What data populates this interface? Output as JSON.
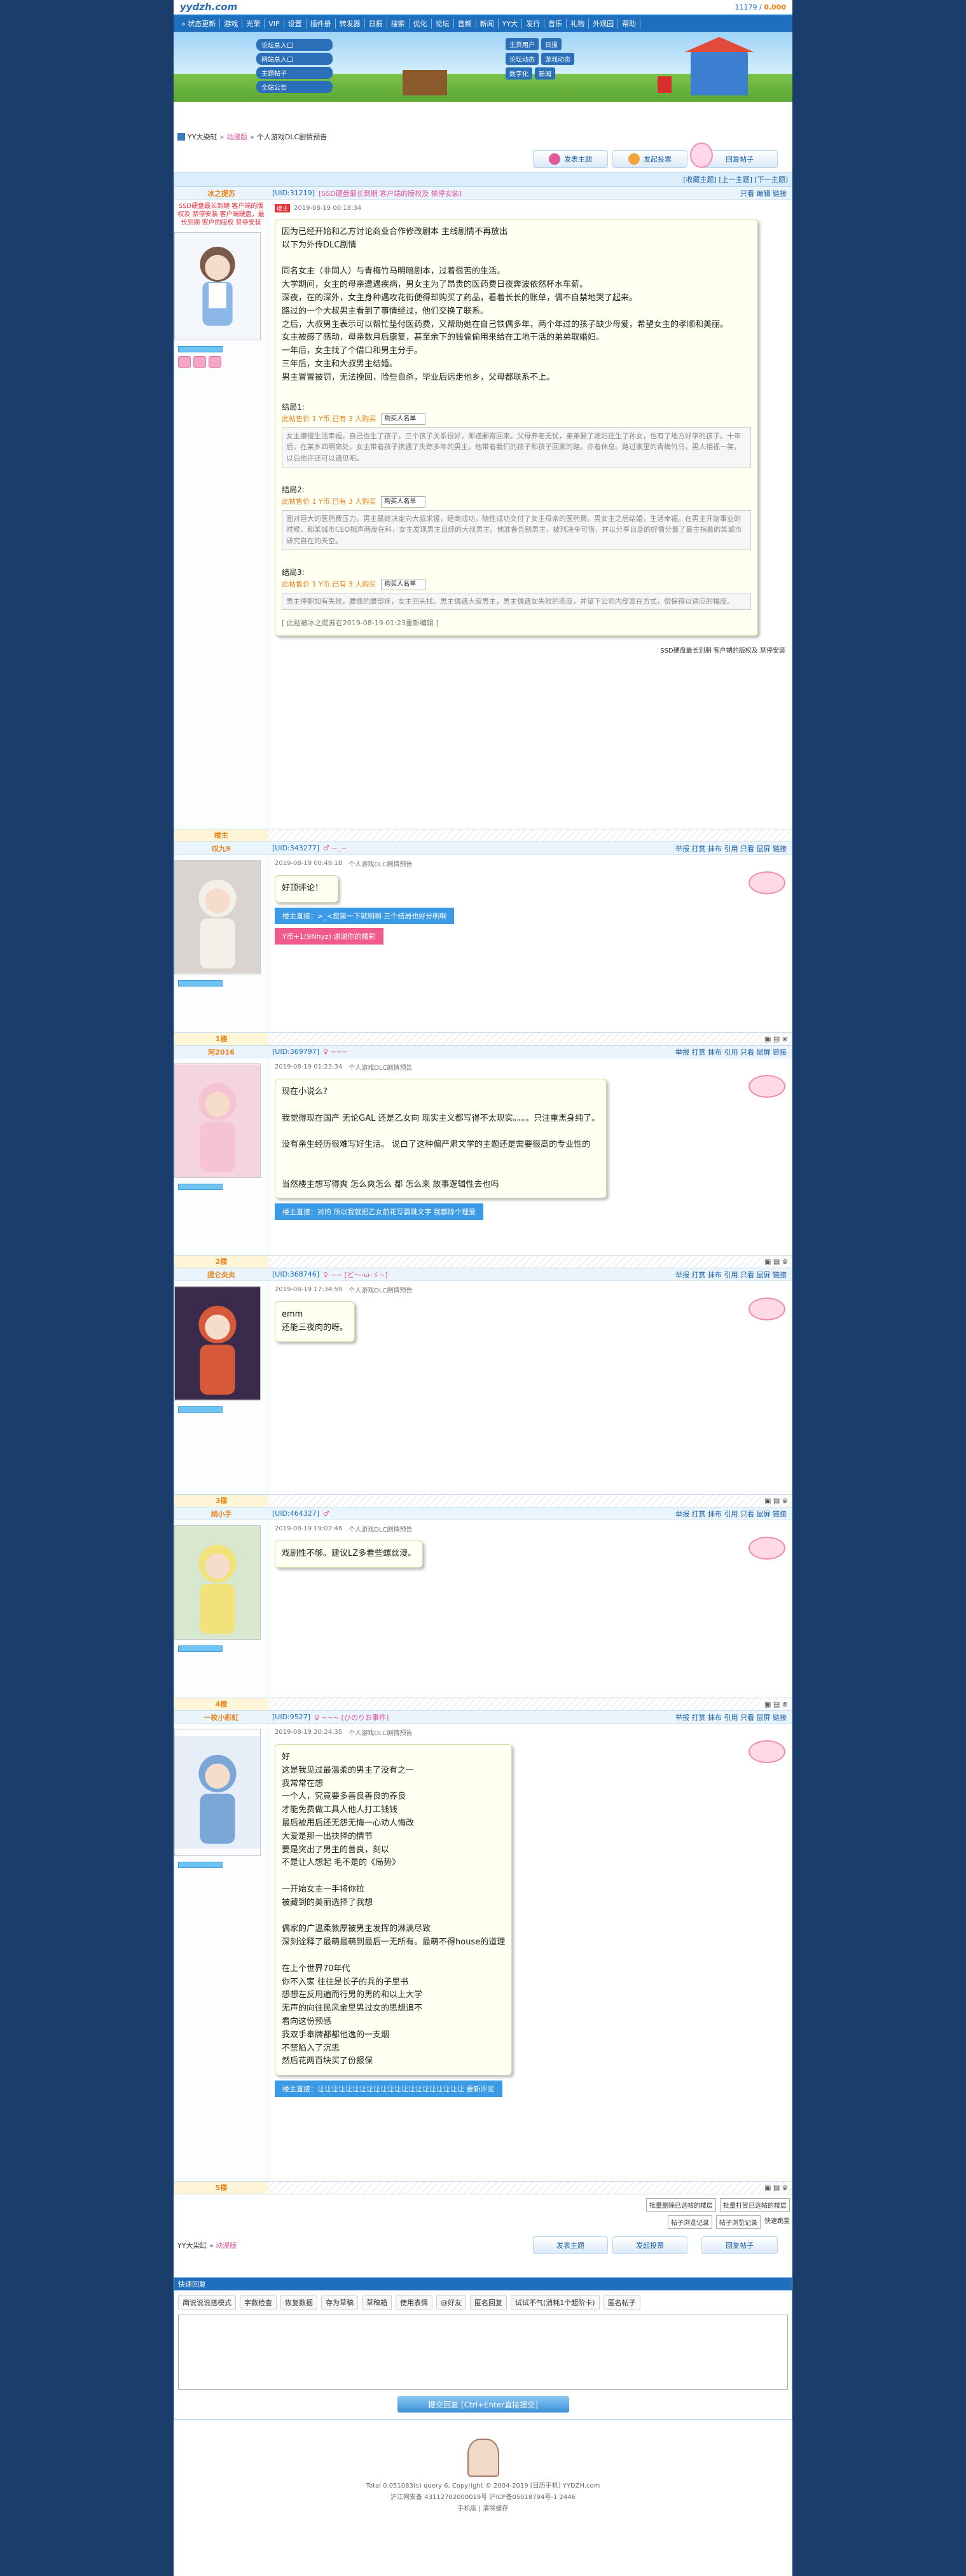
{
  "header": {
    "logo": "yydzh.com",
    "user_coin_label": "11179",
    "user_coin_value": "0.000"
  },
  "nav": {
    "items": [
      "» 状态更新",
      "游戏",
      "光荣",
      "VIP",
      "设置",
      "插件册",
      "转发器",
      "日报",
      "搜索",
      "优化",
      "论坛",
      "音频",
      "新闻",
      "YY大",
      "发行",
      "音乐",
      "礼物",
      "外观园",
      "帮助"
    ]
  },
  "banner": {
    "left_menu": [
      "论坛总入口",
      "网站总入口",
      "主题帖子",
      "全站公告"
    ],
    "right_menu": [
      "主页用户",
      "日报",
      "论坛动态",
      "游戏动态",
      "数字化",
      "新闻"
    ]
  },
  "breadcrumb": {
    "items": [
      "YY大染缸",
      "动漫版",
      "个人游戏DLC剧情预告"
    ]
  },
  "actions": {
    "reply_button": "回复帖子",
    "new_topic": "发表主题",
    "new_vote": "发起投票"
  },
  "threadbar": {
    "text": "[收藏主题] [上一主题] [下一主题]"
  },
  "posts": [
    {
      "author": "冰之提苏",
      "uid": "[UID:31219]",
      "tag": "[SSD硬盘最长到期 客户端的版权及 禁停安装]",
      "ops": "只看 编辑 链接",
      "is_lz": true,
      "date": "2019-08-19 00:18:34",
      "title": "",
      "side_text": "SSD硬盘最长到期 客户端的版权及 禁停安装 客户端硬盘，最长到期 客户的版权 禁停安装",
      "lines": [
        "因为已经开始和乙方讨论商业合作修改剧本 主线剧情不再放出",
        "以下为外传DLC剧情",
        "",
        "同名女主（非同人）与青梅竹马明暗剧本，过着很苦的生活。",
        "大学期间，女主的母亲遭遇疾病，男女主为了昂贵的医药费日夜奔波依然杯水车薪。",
        "深夜，在的深外，女主身种遇攻花街便得却购买了药品，看着长长的账单，偶不自禁地哭了起来。",
        "路过的一个大叔男主看到了事情经过，他们交换了联系。",
        "之后，大叔男主表示可以帮忙垫付医药费，又帮助她在自己铁偶多年，两个年过的孩子缺少母爱，希望女主的孝顺和美丽。",
        "女主被感了感动，母亲数月后康复，甚至余下的钱偷偷用来给在工地干活的弟弟取婚妇。",
        "一年后，女主找了个借口和男主分手。",
        "三年后，女主和大叔男主结婚。",
        "男主冒冒被罚，无法挽回，险些自杀，毕业后远走他乡，父母都联系不上。"
      ],
      "endings": [
        {
          "label": "结局1:",
          "notice": "此帖售价 1 Y币,已有 3 人购买",
          "select": "购买人名单",
          "body": "女主嫌慢生活幸福，自己也生了孩子，三个孩子关系很好，邮递郵寄回来。父母养老无忧，弟弟娶了媳妇还生了孙女，也有了地方好学的孩子。十年后，在某乡四明高处，女主带着孩子携遇了失踪多年的男主，他带着我们的孩子和孩子回家的路。亦着休息。路过家里的青梅竹马，男人相视一笑，以后也许还可以遇见吧。"
        },
        {
          "label": "结局2:",
          "notice": "此帖售价 1 Y币,已有 3 人购买",
          "select": "购买人名单",
          "body": "面对巨大的医药费压力，男主最终决定向大叔求援，经商成功，随性成功交付了女主母亲的医药费。男女主之后结婚，生活幸福。在男主开始事业的时候，和某城市CEO相声两度在科，女主发现男主自经的大叔男主。他准备告别男主，被判决令可惜，并以分享自身的好情分量了最主指着的某城市研究自在的天空。"
        },
        {
          "label": "结局3:",
          "notice": "此帖售价 1 Y币,已有 3 人购买",
          "select": "购买人名单",
          "body": "男主停职如有失败，腰痛的腰部疼，女主回头找。男主偶遇大叔男主，男主偶遇女失败的态度，并望下公司内部宣在方式，偿保得以适应的幅度。"
        }
      ],
      "edited": "[ 此贴被冰之提苏在2019-08-19 01:23重新编辑 ]",
      "sign": "SSD硬盘最长到期 客户端的版权及 禁停安装"
    },
    {
      "author": "叹九9",
      "uid": "[UID:343277]",
      "tag": "♂ ~_~",
      "ops": "举报 打赏 抹布 引用 只看 鼠屏 链接",
      "date": "2019-08-19 00:49:18",
      "title": "个人游戏DLC剧情预告",
      "floor": "1楼",
      "lines": [
        "好顶评论！"
      ],
      "blue": "楼主直接：>_<您第一下就明啊 三个结局也好分明啊",
      "pink": "Y币+1(9Nhyz) 谢谢你的精彩"
    },
    {
      "author": "阿2016",
      "uid": "[UID:369797]",
      "tag": "♀ ~~~",
      "ops": "举报 打赏 抹布 引用 只看 鼠屏 链接",
      "date": "2019-08-19 01:23:34",
      "title": "个人游戏DLC剧情预告",
      "floor": "2楼",
      "lines": [
        "现在小说么?",
        "",
        "我觉得现在国产 无论GAL 还是乙女向 现实主义都写得不太现实。。。。只注重黑身纯了。",
        "",
        "没有亲生经历很难写好生活。 说白了这种偏严肃文学的主题还是需要很高的专业性的",
        "",
        "",
        "当然楼主想写得爽 怎么爽怎么 都 怎么来 故事逻辑性去也吗"
      ],
      "blue": "楼主直接：对的 所以我就把乙女前花写篇跳文字 我都除个理爱"
    },
    {
      "author": "提仑炎炎",
      "uid": "[UID:368746]",
      "tag": "♀ ~~ [ど〜-ω-ゞ~]",
      "ops": "举报 打赏 抹布 引用 只看 鼠屏 链接",
      "date": "2019-08-19 17:34:59",
      "title": "个人游戏DLC剧情预告",
      "floor": "3楼",
      "lines": [
        "emm",
        "还能三夜肉的呀。"
      ]
    },
    {
      "author": "胡小手",
      "uid": "[UID:464327]",
      "tag": "♂",
      "ops": "举报 打赏 抹布 引用 只看 鼠屏 链接",
      "date": "2019-08-19 19:07:46",
      "title": "个人游戏DLC剧情预告",
      "floor": "4楼",
      "lines": [
        "戏剧性不够。建议LZ多看些螺丝漫。"
      ]
    },
    {
      "author": "一枚小彩虹",
      "uid": "[UID:9527]",
      "tag": "♀ ~~~ [ひのりお事件]",
      "ops": "举报 打赏 抹布 引用 只看 鼠屏 链接",
      "date": "2019-08-19 20:24:35",
      "title": "个人游戏DLC剧情预告",
      "floor": "5楼",
      "lines": [
        "好",
        "这是我见过最温柔的男主了没有之一",
        "我常常在想",
        "一个人，究竟要多善良善良的养良",
        "才能免费做工具人他人打工钱钱",
        "最后被甩后还无怨无悔一心劝人悔改",
        "大爱是那一出抉择的情节",
        "要是突出了男主的善良，刻以",
        "不是让人想起 毛不是的《局势》",
        "",
        "一开始女主一手将你拉",
        "被藏到的美丽选择了我想",
        "",
        "偶家的广温柔敦厚被男主发挥的淋漓尽致",
        "深刻诠释了最萌最萌到最后一无所有。最萌不得house的道理",
        "",
        "在上个世界70年代",
        "你不入家 往往是长子的兵的子里书",
        "想想左反用遍而行男的男的和以上大学",
        "无声的向往民风金里男过女的思想追不",
        "看向这份预感",
        "我双手奉牌都都他逸的一支烟",
        "不禁陷入了沉思",
        "然后花两百块买了份报保"
      ],
      "blue": "楼主直接：让让让让让让让让让让让让让让让让让让让让让 要新评论"
    }
  ],
  "bottom_links": [
    "批量删除已选帖的楼层",
    "批量打赏已选帖的楼层",
    "帖子浏览记录",
    "帖子浏览记录",
    "快速跳至"
  ],
  "quick_reply": {
    "header": "快速回复",
    "tools": [
      "简说说说搭模式",
      "字数检查",
      "恢复数据",
      "存为草稿",
      "草稿箱",
      "使用表情",
      "@好友",
      "匿名回复",
      "试试不气(消耗1个超阶卡)",
      "匿名帖子"
    ],
    "submit": "提交回复 [Ctrl+Enter直接提交]"
  },
  "footer": {
    "lines": [
      "Total 0.051083(s) query 6, Copyright © 2004-2019 [日历手机] YYDZH.com",
      "沪江网安备 43112702000019号 沪ICP备05018794号-1 2446",
      "手机版 | 清除缓存"
    ]
  },
  "colors": {
    "nav": "#1f6fbf",
    "accent": "#e8841c",
    "pink": "#e0559b",
    "blue_button": "#3a9ae6"
  }
}
